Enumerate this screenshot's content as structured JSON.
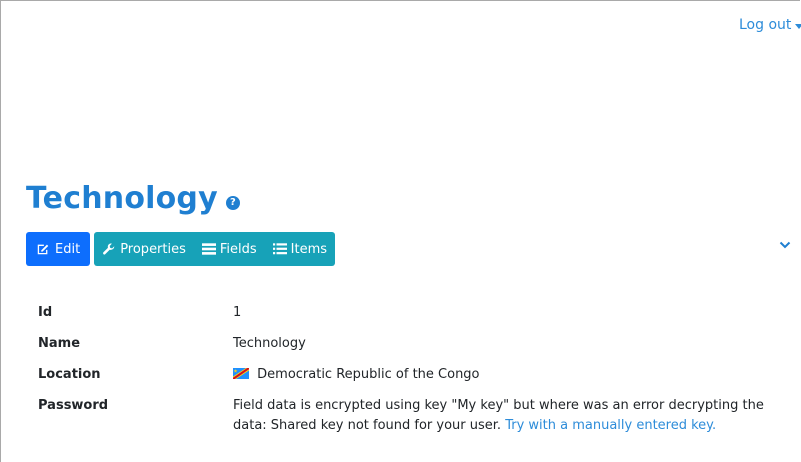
{
  "header": {
    "logout_label": "Log out"
  },
  "page": {
    "title": "Technology",
    "help_icon_glyph": "?"
  },
  "toolbar": {
    "edit_label": "Edit",
    "properties_label": "Properties",
    "fields_label": "Fields",
    "items_label": "Items"
  },
  "details": {
    "id_label": "Id",
    "id_value": "1",
    "name_label": "Name",
    "name_value": "Technology",
    "location_label": "Location",
    "location_value": "Democratic Republic of the Congo",
    "password_label": "Password",
    "password_value": "Field data is encrypted using key \"My key\" but where was an error decrypting the data: Shared key not found for your user.",
    "password_link": "Try with a manually entered key."
  },
  "icons": {
    "help": "question-circle-icon",
    "edit": "edit-icon",
    "properties": "wrench-icon",
    "fields": "table-icon",
    "items": "list-icon",
    "chevron": "chevron-down-icon",
    "flag": "flag-icon-cd"
  },
  "colors": {
    "title": "#1f7fd1",
    "link": "#2d8cd9",
    "edit_button": "#0d6efd",
    "toolbar_group": "#17a2b8"
  }
}
